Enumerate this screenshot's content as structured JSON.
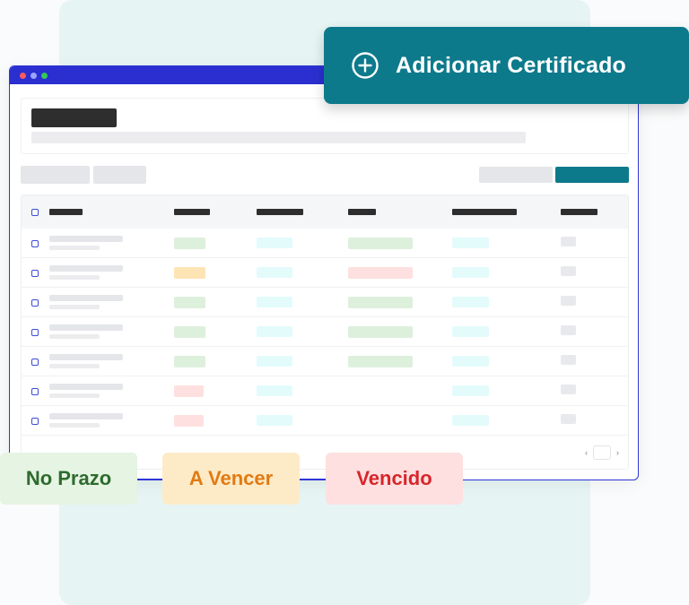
{
  "add_button": {
    "label": "Adicionar Certificado",
    "icon": "plus-circle-icon"
  },
  "statuses": [
    {
      "label": "No Prazo",
      "color": "#2e6b2e",
      "bg": "#e5f4e3"
    },
    {
      "label": "A Vencer",
      "color": "#e27a12",
      "bg": "#fdebc8"
    },
    {
      "label": "Vencido",
      "color": "#d7262b",
      "bg": "#fde0df"
    }
  ],
  "colors": {
    "accent": "#0d7a8c",
    "window_border": "#2f35d6",
    "window_dots": [
      "#ff5a5f",
      "#9aa5ff",
      "#34c759"
    ]
  },
  "table": {
    "row_count": 7,
    "status_colors": [
      "green",
      "amber",
      "green",
      "green",
      "green",
      "red",
      "red"
    ],
    "alert_colors": [
      "green",
      "red",
      "green",
      "green",
      "green",
      null,
      null
    ]
  }
}
